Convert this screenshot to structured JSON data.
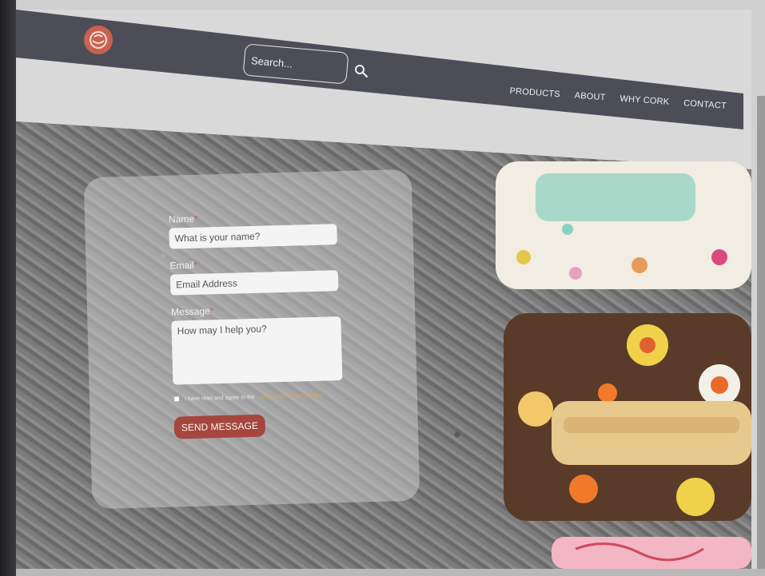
{
  "search": {
    "placeholder": "Search..."
  },
  "nav": {
    "items": [
      {
        "label": "PRODUCTS"
      },
      {
        "label": "ABOUT"
      },
      {
        "label": "WHY CORK"
      },
      {
        "label": "CONTACT"
      }
    ]
  },
  "form": {
    "name_label": "Name",
    "name_placeholder": "What is your name?",
    "email_label": "Email",
    "email_placeholder": "Email Address",
    "message_label": "Message",
    "message_placeholder": "How may I help you?",
    "required_mark": "*",
    "agree_text": "I have read and agree to the",
    "terms_link": "Terms and Privacy Policy",
    "submit_label": "SEND MESSAGE"
  },
  "colors": {
    "header": "#4c4d57",
    "accent": "#a6463e",
    "logo": "#c9614f",
    "link": "#e3a35b"
  }
}
